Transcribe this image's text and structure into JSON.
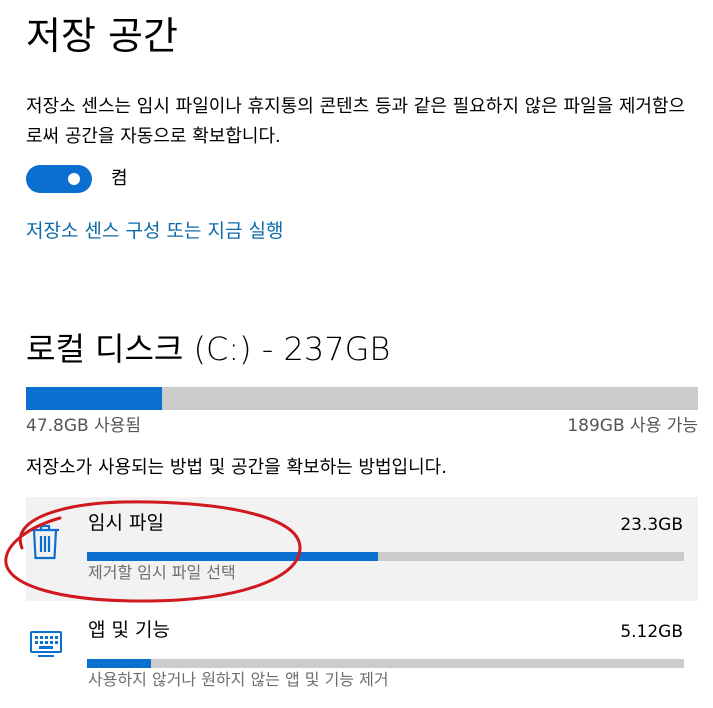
{
  "page": {
    "title": "저장 공간"
  },
  "storage_sense": {
    "description": "저장소 센스는 임시 파일이나 휴지통의 콘텐츠 등과 같은 필요하지 않은 파일을 제거함으로써 공간을 자동으로 확보합니다.",
    "toggle_state": "켬",
    "toggle_on": true,
    "configure_link": "저장소 센스 구성 또는 지금 실행"
  },
  "drive": {
    "title": "로컬 디스크 (C:) - 237GB",
    "used_label": "47.8GB 사용됨",
    "free_label": "189GB 사용 가능",
    "used_fraction": 0.202
  },
  "usage": {
    "description": "저장소가 사용되는 방법 및 공간을 확보하는 방법입니다.",
    "categories": [
      {
        "icon": "trash-icon",
        "name": "임시 파일",
        "size": "23.3GB",
        "description": "제거할 임시 파일 선택",
        "fraction": 0.487
      },
      {
        "icon": "keyboard-icon",
        "name": "앱 및 기능",
        "size": "5.12GB",
        "description": "사용하지 않거나 원하지 않는 앱 및 기능 제거",
        "fraction": 0.107
      }
    ]
  },
  "colors": {
    "accent": "#0a6fcf",
    "link": "#0b6aa8",
    "bar_track": "#cccccc",
    "hover_bg": "#f2f2f2",
    "annotation_circle": "#d0181f"
  }
}
